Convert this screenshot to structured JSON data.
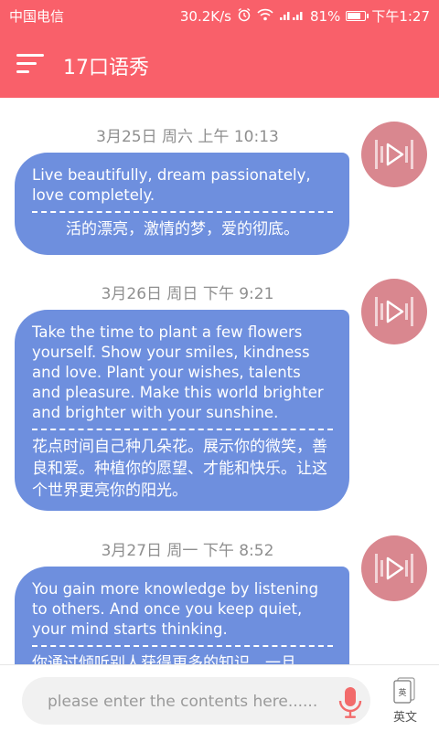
{
  "status_bar": {
    "carrier": "中国电信",
    "net_speed": "30.2K/s",
    "battery": "81%",
    "time": "下午1:27",
    "battery_level": 0.81
  },
  "app_bar": {
    "title": "17口语秀",
    "menu_icon": "menu-icon"
  },
  "messages": [
    {
      "date": "3月25日 周六 上午 10:13",
      "en": "Live beautifully, dream passionately, love completely.",
      "zh": "活的漂亮，激情的梦，爱的彻底。"
    },
    {
      "date": "3月26日 周日 下午 9:21",
      "en": "Take the time to plant a few flowers yourself. Show your smiles, kindness and love. Plant your wishes, talents and pleasure. Make this world brighter and brighter with your sunshine.",
      "zh": "花点时间自己种几朵花。展示你的微笑，善良和爱。种植你的愿望、才能和快乐。让这个世界更亮你的阳光。"
    },
    {
      "date": "3月27日 周一 下午 8:52",
      "en": "You gain more knowledge by listening to others. And once you keep quiet, your mind starts thinking.",
      "zh": "你通过倾听别人获得更多的知识。一旦"
    }
  ],
  "input": {
    "placeholder": "please enter the contents here......",
    "value": ""
  },
  "language_toggle": {
    "label": "英文",
    "badge": "英"
  },
  "colors": {
    "primary": "#f9606a",
    "bubble": "#6e8fde",
    "play_button": "#d9878f",
    "mic": "#f26b6b"
  }
}
